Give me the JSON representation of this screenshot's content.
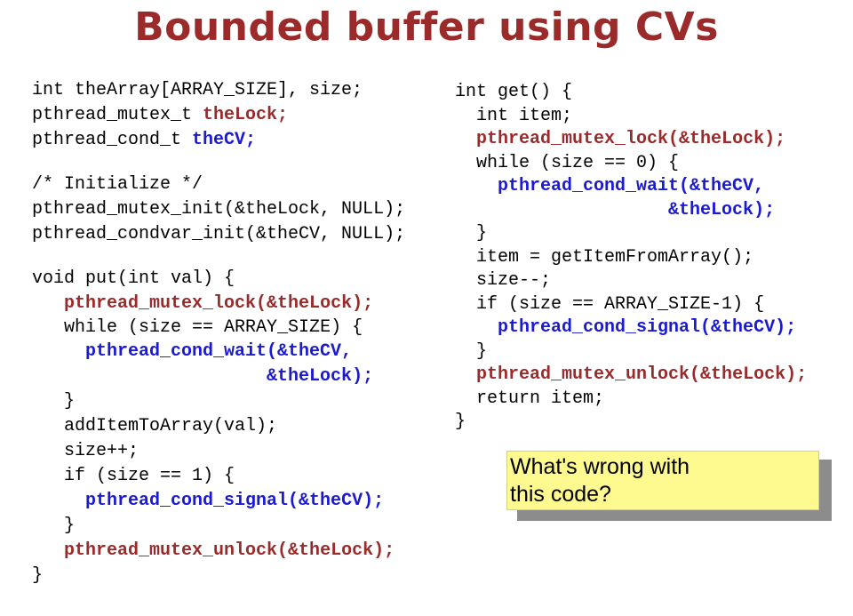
{
  "title": "Bounded buffer using CVs",
  "left_code": [
    {
      "indent": "",
      "parts": [
        {
          "t": "int theArray[ARRAY_SIZE], size;",
          "c": ""
        }
      ]
    },
    {
      "indent": "",
      "parts": [
        {
          "t": "pthread_mutex_t ",
          "c": ""
        },
        {
          "t": "theLock;",
          "c": "red"
        }
      ]
    },
    {
      "indent": "",
      "parts": [
        {
          "t": "pthread_cond_t ",
          "c": ""
        },
        {
          "t": "theCV;",
          "c": "blue"
        }
      ]
    },
    {
      "gap": true
    },
    {
      "indent": "",
      "parts": [
        {
          "t": "/* Initialize */",
          "c": ""
        }
      ]
    },
    {
      "indent": "",
      "parts": [
        {
          "t": "pthread_mutex_init(&theLock, NULL);",
          "c": ""
        }
      ]
    },
    {
      "indent": "",
      "parts": [
        {
          "t": "pthread_condvar_init(&theCV, NULL);",
          "c": ""
        }
      ]
    },
    {
      "gap": true
    },
    {
      "indent": "",
      "parts": [
        {
          "t": "void put(int val) {",
          "c": ""
        }
      ]
    },
    {
      "indent": "   ",
      "parts": [
        {
          "t": "pthread_mutex_lock(&theLock);",
          "c": "red"
        }
      ]
    },
    {
      "indent": "   ",
      "short": true,
      "parts": [
        {
          "t": "while (size == ARRAY_SIZE) {",
          "c": ""
        }
      ]
    },
    {
      "indent": "     ",
      "parts": [
        {
          "t": "pthread_cond_wait(&theCV,",
          "c": "blue"
        }
      ]
    },
    {
      "indent": "                      ",
      "parts": [
        {
          "t": "&theLock);",
          "c": "blue"
        }
      ]
    },
    {
      "indent": "   ",
      "parts": [
        {
          "t": "}",
          "c": ""
        }
      ]
    },
    {
      "indent": "   ",
      "parts": [
        {
          "t": "addItemToArray(val);",
          "c": ""
        }
      ]
    },
    {
      "indent": "   ",
      "parts": [
        {
          "t": "size++;",
          "c": ""
        }
      ]
    },
    {
      "indent": "   ",
      "parts": [
        {
          "t": "if (size == 1) {",
          "c": ""
        }
      ]
    },
    {
      "indent": "     ",
      "parts": [
        {
          "t": "pthread_cond_signal(&theCV);",
          "c": "blue"
        }
      ]
    },
    {
      "indent": "   ",
      "parts": [
        {
          "t": "}",
          "c": ""
        }
      ]
    },
    {
      "indent": "   ",
      "parts": [
        {
          "t": "pthread_mutex_unlock(&theLock);",
          "c": "red"
        }
      ]
    },
    {
      "indent": "",
      "parts": [
        {
          "t": "}",
          "c": ""
        }
      ]
    }
  ],
  "right_code": [
    {
      "indent": "",
      "parts": [
        {
          "t": "int get() {",
          "c": ""
        }
      ]
    },
    {
      "indent": "  ",
      "parts": [
        {
          "t": "int item;",
          "c": ""
        }
      ]
    },
    {
      "indent": "  ",
      "parts": [
        {
          "t": "pthread_mutex_lock(&theLock);",
          "c": "red"
        }
      ]
    },
    {
      "indent": "  ",
      "parts": [
        {
          "t": "while (size == 0) {",
          "c": ""
        }
      ]
    },
    {
      "indent": "    ",
      "parts": [
        {
          "t": "pthread_cond_wait(&theCV,",
          "c": "blue"
        }
      ]
    },
    {
      "indent": "                    ",
      "parts": [
        {
          "t": "&theLock);",
          "c": "blue"
        }
      ]
    },
    {
      "indent": "  ",
      "parts": [
        {
          "t": "}",
          "c": ""
        }
      ]
    },
    {
      "indent": "  ",
      "parts": [
        {
          "t": "item = getItemFromArray();",
          "c": ""
        }
      ]
    },
    {
      "indent": "  ",
      "parts": [
        {
          "t": "size--;",
          "c": ""
        }
      ]
    },
    {
      "indent": "  ",
      "parts": [
        {
          "t": "if (size == ARRAY_SIZE-1) {",
          "c": ""
        }
      ]
    },
    {
      "indent": "    ",
      "parts": [
        {
          "t": "pthread_cond_signal(&theCV);",
          "c": "blue"
        }
      ]
    },
    {
      "indent": "  ",
      "parts": [
        {
          "t": "}",
          "c": ""
        }
      ]
    },
    {
      "indent": "  ",
      "parts": [
        {
          "t": "pthread_mutex_unlock(&theLock);",
          "c": "red"
        }
      ]
    },
    {
      "indent": "  ",
      "parts": [
        {
          "t": "return item;",
          "c": ""
        }
      ]
    },
    {
      "indent": "",
      "parts": [
        {
          "t": "}",
          "c": ""
        }
      ]
    }
  ],
  "callout": {
    "line1": "What's wrong with",
    "line2": "this code?"
  },
  "colors": {
    "title": "#9b2a2a",
    "lock_highlight": "#9b2a2a",
    "cv_highlight": "#1a1ad6",
    "callout_bg": "#fffa90",
    "callout_shadow": "#8c8c8c"
  }
}
